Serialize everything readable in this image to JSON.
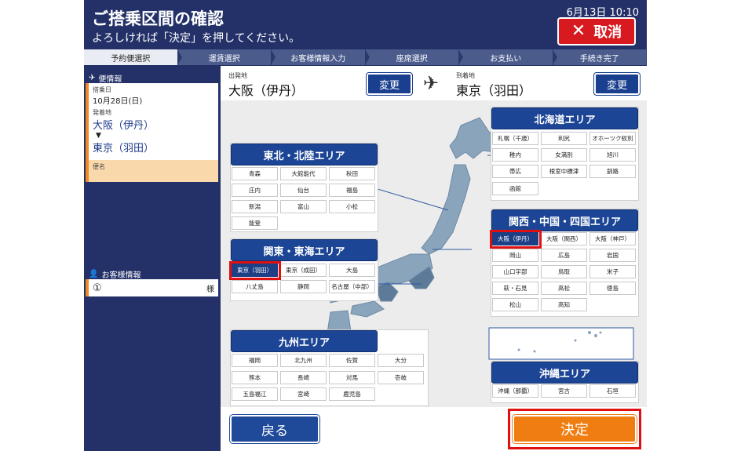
{
  "header": {
    "title": "ご搭乗区間の確認",
    "subtitle": "よろしければ「決定」を押してください。",
    "datetime": "6月13日 10:10",
    "cancel_label": "取消"
  },
  "steps": [
    "予約便選択",
    "運賃選択",
    "お客様情報入力",
    "座席選択",
    "お支払い",
    "手続き完了"
  ],
  "sidebar": {
    "flight_heading": "便情報",
    "board_date_label": "搭乗日",
    "board_date": "10月28日(日)",
    "route_label": "発着地",
    "from": "大阪（伊丹）",
    "arrow": "▼",
    "to": "東京（羽田）",
    "flight_no_label": "便名",
    "customer_heading": "お客様情報",
    "customer_num": "①",
    "customer_suffix": "様"
  },
  "route": {
    "dep_label": "出発地",
    "dep_city": "大阪（伊丹）",
    "arr_label": "到着地",
    "arr_city": "東京（羽田）",
    "change_label": "変更"
  },
  "areas": {
    "hokkaido": {
      "title": "北海道エリア",
      "airports": [
        "札幌（千歳）",
        "利尻",
        "オホーツク紋別",
        "稚内",
        "女満別",
        "旭川",
        "帯広",
        "根室中標津",
        "釧路",
        "函館"
      ]
    },
    "tohoku": {
      "title": "東北・北陸エリア",
      "airports": [
        "青森",
        "大館能代",
        "秋田",
        "庄内",
        "仙台",
        "福島",
        "新潟",
        "富山",
        "小松",
        "能登"
      ]
    },
    "kanto": {
      "title": "関東・東海エリア",
      "airports": [
        "東京（羽田）",
        "東京（成田）",
        "大島",
        "八丈島",
        "静岡",
        "名古屋（中部）"
      ]
    },
    "kansai": {
      "title": "関西・中国・四国エリア",
      "airports": [
        "大阪（伊丹）",
        "大阪（関西）",
        "大阪（神戸）",
        "岡山",
        "広島",
        "岩国",
        "山口宇部",
        "鳥取",
        "米子",
        "萩・石見",
        "高松",
        "徳島",
        "松山",
        "高知"
      ]
    },
    "kyushu": {
      "title": "九州エリア",
      "airports": [
        "福岡",
        "北九州",
        "佐賀",
        "大分",
        "熊本",
        "長崎",
        "対馬",
        "壱岐",
        "五島福江",
        "宮崎",
        "鹿児島"
      ]
    },
    "okinawa": {
      "title": "沖縄エリア",
      "airports": [
        "沖縄（那覇）",
        "宮古",
        "石垣"
      ]
    }
  },
  "footer": {
    "back_label": "戻る",
    "confirm_label": "決定"
  },
  "colors": {
    "navy": "#243168",
    "area_header": "#1c4596",
    "accent_orange": "#f07d12",
    "cancel_red": "#d71920",
    "highlight": "#e01010"
  }
}
